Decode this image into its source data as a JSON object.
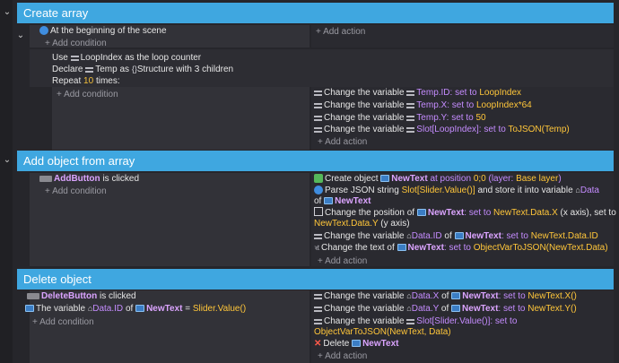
{
  "add_condition": "+ Add condition",
  "add_action": "+ Add action",
  "collapse_icon": "chevron-down-icon",
  "groups": [
    {
      "title": "Create array"
    },
    {
      "title": "Add object from array"
    },
    {
      "title": "Delete object"
    }
  ],
  "ev1": {
    "cond": "At the beginning of the scene",
    "use_pre": "Use",
    "use_var": "LoopIndex",
    "use_post": "as the loop counter",
    "declare_pre": "Declare",
    "declare_var": "Temp",
    "declare_as": "as",
    "declare_type": "Structure with 3 children",
    "repeat_pre": "Repeat",
    "repeat_n": "10",
    "repeat_post": "times:",
    "actions": [
      {
        "pre": "Change the variable",
        "var": "Temp.ID",
        "mid": ": set to",
        "val": "LoopIndex"
      },
      {
        "pre": "Change the variable",
        "var": "Temp.X",
        "mid": ": set to",
        "val": "LoopIndex*64"
      },
      {
        "pre": "Change the variable",
        "var": "Temp.Y",
        "mid": ": set to",
        "val": "50"
      },
      {
        "pre": "Change the variable",
        "var": "Slot[LoopIndex]",
        "mid": ": set to",
        "val": "ToJSON(Temp)"
      }
    ]
  },
  "ev2": {
    "cond_obj": "AddButton",
    "cond_post": "is clicked",
    "create_pre": "Create object",
    "create_obj": "NewText",
    "create_mid": "at position",
    "create_pos": "0;0",
    "create_layer_pre": "(layer:",
    "create_layer": "Base layer",
    "create_layer_post": ")",
    "parse_pre": "Parse JSON string",
    "parse_val": "Slot[Slider.Value()]",
    "parse_mid": "and store it into variable",
    "parse_var": "Data",
    "parse_of": "of",
    "parse_obj": "NewText",
    "pos_pre": "Change the position of",
    "pos_obj": "NewText",
    "pos_mid": ": set to",
    "pos_x": "NewText.Data.X",
    "pos_x_post": "(x axis), set to",
    "pos_y": "NewText.Data.Y",
    "pos_y_post": "(y axis)",
    "var_pre": "Change the variable",
    "var_name": "Data.ID",
    "var_of": "of",
    "var_obj": "NewText",
    "var_mid": ": set to",
    "var_val": "NewText.Data.ID",
    "text_pre": "Change the text of",
    "text_obj": "NewText",
    "text_mid": ": set to",
    "text_val": "ObjectVarToJSON(NewText.Data)"
  },
  "ev3": {
    "cond_obj": "DeleteButton",
    "cond_post": "is clicked",
    "cond2_pre": "The variable",
    "cond2_var": "Data.ID",
    "cond2_of": "of",
    "cond2_obj": "NewText",
    "cond2_eq": "=",
    "cond2_val": "Slider.Value()",
    "a1_pre": "Change the variable",
    "a1_var": "Data.X",
    "a1_of": "of",
    "a1_obj": "NewText",
    "a1_mid": ": set to",
    "a1_val": "NewText.X()",
    "a2_pre": "Change the variable",
    "a2_var": "Data.Y",
    "a2_of": "of",
    "a2_obj": "NewText",
    "a2_mid": ": set to",
    "a2_val": "NewText.Y()",
    "a3_pre": "Change the variable",
    "a3_var": "Slot[Slider.Value()]",
    "a3_mid": ": set to",
    "a3_val": "ObjectVarToJSON(NewText, Data)",
    "a4_pre": "Delete",
    "a4_obj": "NewText"
  }
}
